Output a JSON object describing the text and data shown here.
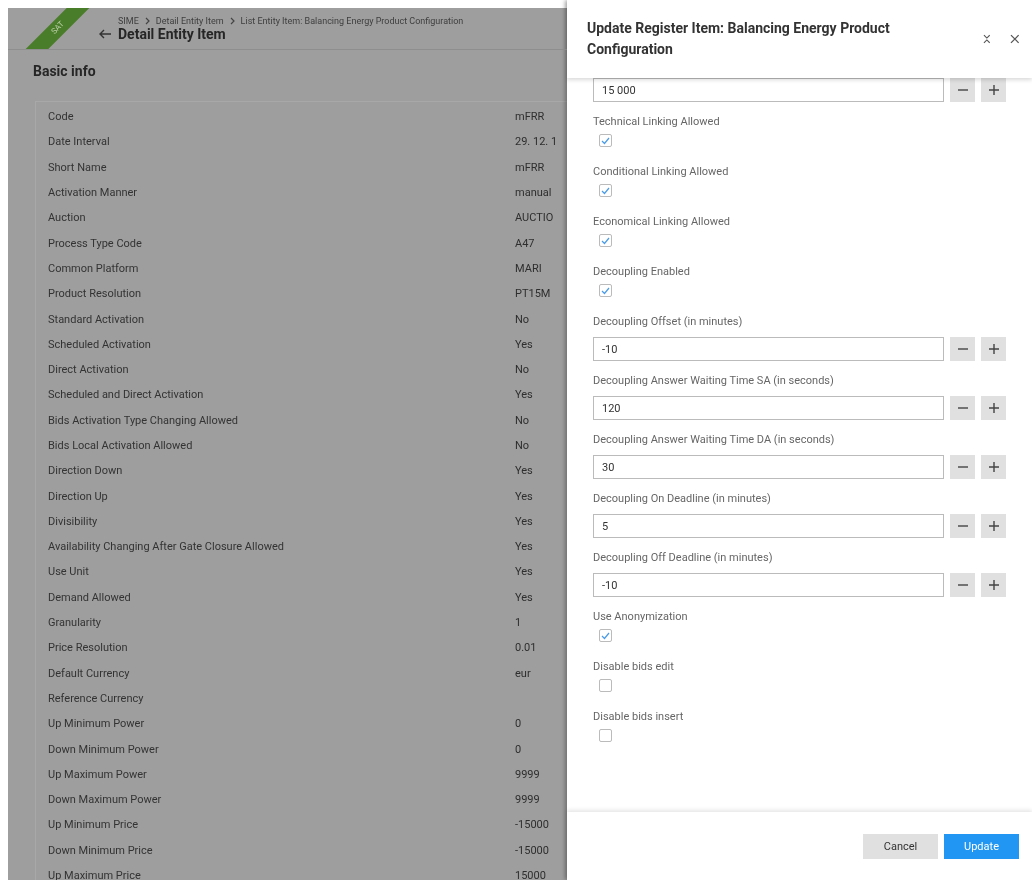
{
  "page": {
    "badge": "SAT",
    "breadcrumb": [
      "SIME",
      "Detail Entity Item",
      "List Entity Item: Balancing Energy Product Configuration"
    ],
    "title": "Detail Entity Item",
    "section_title": "Basic info",
    "rows": [
      {
        "label": "Code",
        "value": "mFRR"
      },
      {
        "label": "Date Interval",
        "value": "29. 12. 1"
      },
      {
        "label": "Short Name",
        "value": "mFRR"
      },
      {
        "label": "Activation Manner",
        "value": "manual"
      },
      {
        "label": "Auction",
        "value": "AUCTIO"
      },
      {
        "label": "Process Type Code",
        "value": "A47"
      },
      {
        "label": "Common Platform",
        "value": "MARI"
      },
      {
        "label": "Product Resolution",
        "value": "PT15M"
      },
      {
        "label": "Standard Activation",
        "value": "No"
      },
      {
        "label": "Scheduled Activation",
        "value": "Yes"
      },
      {
        "label": "Direct Activation",
        "value": "No"
      },
      {
        "label": "Scheduled and Direct Activation",
        "value": "Yes"
      },
      {
        "label": "Bids Activation Type Changing Allowed",
        "value": "No"
      },
      {
        "label": "Bids Local Activation Allowed",
        "value": "No"
      },
      {
        "label": "Direction Down",
        "value": "Yes"
      },
      {
        "label": "Direction Up",
        "value": "Yes"
      },
      {
        "label": "Divisibility",
        "value": "Yes"
      },
      {
        "label": "Availability Changing After Gate Closure Allowed",
        "value": "Yes"
      },
      {
        "label": "Use Unit",
        "value": "Yes"
      },
      {
        "label": "Demand Allowed",
        "value": "Yes"
      },
      {
        "label": "Granularity",
        "value": "1"
      },
      {
        "label": "Price Resolution",
        "value": "0.01"
      },
      {
        "label": "Default Currency",
        "value": "eur"
      },
      {
        "label": "Reference Currency"
      },
      {
        "label": "Up Minimum Power",
        "value": "0"
      },
      {
        "label": "Down Minimum Power",
        "value": "0"
      },
      {
        "label": "Up Maximum Power",
        "value": "9999"
      },
      {
        "label": "Down Maximum Power",
        "value": "9999"
      },
      {
        "label": "Up Minimum Price",
        "value": "-15000"
      },
      {
        "label": "Down Minimum Price",
        "value": "-15000"
      },
      {
        "label": "Up Maximum Price",
        "value": "15000"
      }
    ]
  },
  "dialog": {
    "title": "Update Register Item: Balancing Energy Product Configuration",
    "fields": [
      {
        "kind": "number",
        "value": "15 000"
      },
      {
        "kind": "checkbox",
        "label": "Technical Linking Allowed",
        "checked": true
      },
      {
        "kind": "checkbox",
        "label": "Conditional Linking Allowed",
        "checked": true
      },
      {
        "kind": "checkbox",
        "label": "Economical Linking Allowed",
        "checked": true
      },
      {
        "kind": "checkbox",
        "label": "Decoupling Enabled",
        "checked": true
      },
      {
        "kind": "number",
        "label": "Decoupling Offset (in minutes)",
        "value": "-10"
      },
      {
        "kind": "number",
        "label": "Decoupling Answer Waiting Time SA (in seconds)",
        "value": "120"
      },
      {
        "kind": "number",
        "label": "Decoupling Answer Waiting Time DA (in seconds)",
        "value": "30"
      },
      {
        "kind": "number",
        "label": "Decoupling On Deadline (in minutes)",
        "value": "5"
      },
      {
        "kind": "number",
        "label": "Decoupling Off Deadline (in minutes)",
        "value": "-10"
      },
      {
        "kind": "checkbox",
        "label": "Use Anonymization",
        "checked": true
      },
      {
        "kind": "checkbox",
        "label": "Disable bids edit",
        "checked": false
      },
      {
        "kind": "checkbox",
        "label": "Disable bids insert",
        "checked": false
      }
    ],
    "buttons": [
      {
        "label": "Cancel",
        "kind": "secondary"
      },
      {
        "label": "Update",
        "kind": "primary"
      }
    ]
  }
}
